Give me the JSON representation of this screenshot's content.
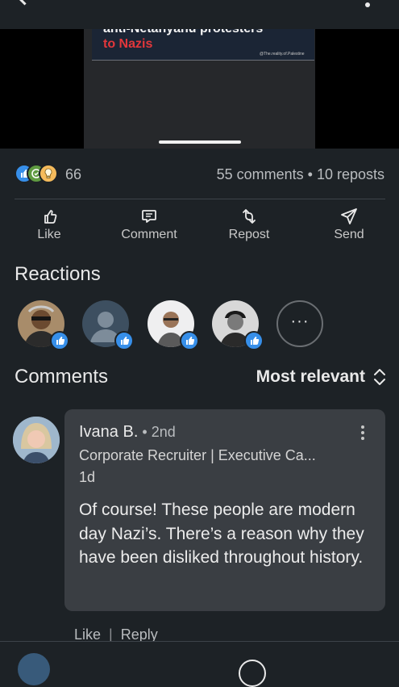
{
  "media": {
    "headline_line1": "anti-Netanyahu protesters",
    "headline_line2": "to Nazis",
    "watermark": "@The.reality.of.Palestine"
  },
  "post_stats": {
    "reaction_count": "66",
    "comments_reposts": "55 comments • 10 reposts"
  },
  "actions": [
    {
      "label": "Like",
      "icon": "thumbs-up-icon"
    },
    {
      "label": "Comment",
      "icon": "comment-icon"
    },
    {
      "label": "Repost",
      "icon": "repost-icon"
    },
    {
      "label": "Send",
      "icon": "send-icon"
    }
  ],
  "reactions": {
    "title": "Reactions",
    "more_label": "···"
  },
  "comments": {
    "title": "Comments",
    "sort_label": "Most relevant",
    "items": [
      {
        "name": "Ivana B.",
        "degree": " • 2nd",
        "headline": "Corporate Recruiter | Executive Ca...",
        "time": "1d",
        "text": "Of course! These people are modern day Nazi’s. There’s a reason why they have been disliked throughout history.",
        "like_label": "Like",
        "separator": "|",
        "reply_label": "Reply"
      }
    ]
  },
  "colors": {
    "background": "#1d2226",
    "bubble": "#3a3e43",
    "like_blue": "#378fe9",
    "headline_red": "#e2373b"
  }
}
